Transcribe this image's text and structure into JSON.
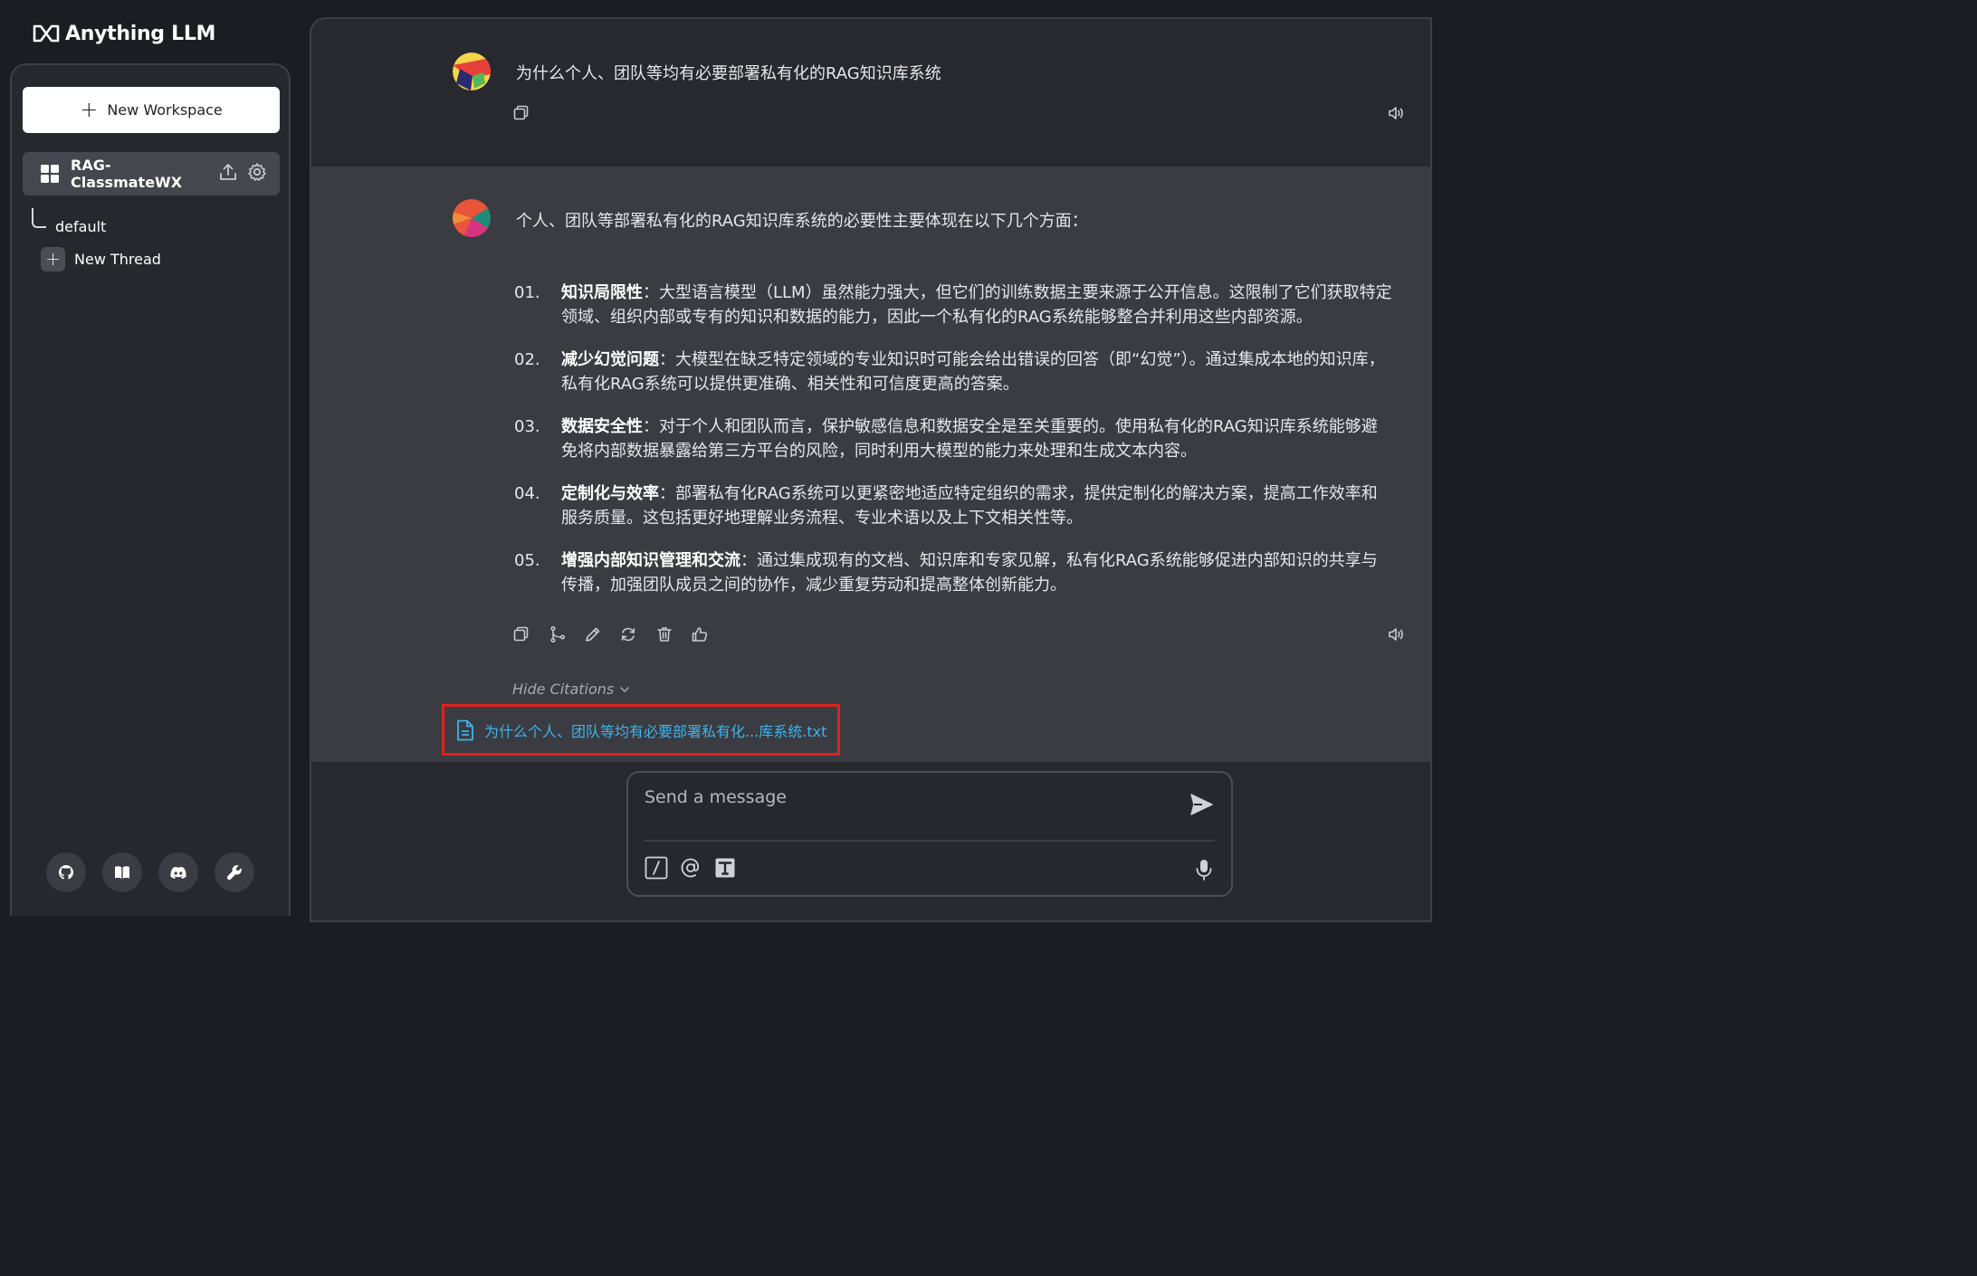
{
  "brand": {
    "name": "Anything LLM"
  },
  "sidebar": {
    "new_workspace_label": "New Workspace",
    "workspace": {
      "name": "RAG-ClassmateWX"
    },
    "threads": [
      {
        "label": "default"
      }
    ],
    "new_thread_label": "New Thread",
    "footer_icons": [
      "github-icon",
      "book-icon",
      "discord-icon",
      "wrench-icon"
    ]
  },
  "chat": {
    "user_message": "为什么个人、团队等均有必要部署私有化的RAG知识库系统",
    "assistant": {
      "intro": "个人、团队等部署私有化的RAG知识库系统的必要性主要体现在以下几个方面：",
      "items": [
        {
          "num": "01.",
          "title": "知识局限性",
          "text": "：大型语言模型（LLM）虽然能力强大，但它们的训练数据主要来源于公开信息。这限制了它们获取特定领域、组织内部或专有的知识和数据的能力，因此一个私有化的RAG系统能够整合并利用这些内部资源。"
        },
        {
          "num": "02.",
          "title": "减少幻觉问题",
          "text": "：大模型在缺乏特定领域的专业知识时可能会给出错误的回答（即“幻觉”）。通过集成本地的知识库，私有化RAG系统可以提供更准确、相关性和可信度更高的答案。"
        },
        {
          "num": "03.",
          "title": "数据安全性",
          "text": "：对于个人和团队而言，保护敏感信息和数据安全是至关重要的。使用私有化的RAG知识库系统能够避免将内部数据暴露给第三方平台的风险，同时利用大模型的能力来处理和生成文本内容。"
        },
        {
          "num": "04.",
          "title": "定制化与效率",
          "text": "：部署私有化RAG系统可以更紧密地适应特定组织的需求，提供定制化的解决方案，提高工作效率和服务质量。这包括更好地理解业务流程、专业术语以及上下文相关性等。"
        },
        {
          "num": "05.",
          "title": "增强内部知识管理和交流",
          "text": "：通过集成现有的文档、知识库和专家见解，私有化RAG系统能够促进内部知识的共享与传播，加强团队成员之间的协作，减少重复劳动和提高整体创新能力。"
        }
      ],
      "hide_citations_label": "Hide Citations",
      "citation_file": "为什么个人、团队等均有必要部署私有化...库系统.txt"
    }
  },
  "composer": {
    "placeholder": "Send a message"
  },
  "colors": {
    "citation_border": "#e0221b",
    "citation_link": "#3fb3ea",
    "assistant_bg": "#3a3c42",
    "main_bg": "#27292e"
  }
}
